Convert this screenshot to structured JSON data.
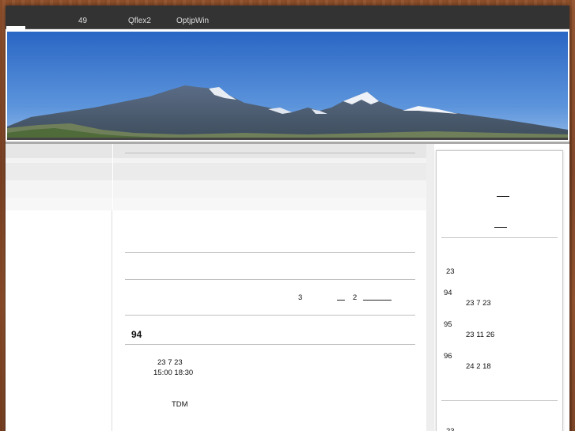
{
  "nav": {
    "items": [
      "49",
      "Qflex2",
      "OptjpWin"
    ]
  },
  "main": {
    "stat_3": "3",
    "stat_2": "2",
    "heading": "94",
    "event_date": "23  7 23",
    "event_time": "15:00   18:30",
    "event_place": "TDM"
  },
  "sidebar": {
    "first": "23",
    "entries": [
      {
        "num": "94",
        "date": "23 7 23"
      },
      {
        "num": "95",
        "date": "23 11 26"
      },
      {
        "num": "96",
        "date": "24 2 18"
      }
    ],
    "bottom_partial": "23"
  },
  "colors": {
    "nav_bg": "#333333",
    "wood": "#8a4a26",
    "sky": "#3a78cc"
  }
}
